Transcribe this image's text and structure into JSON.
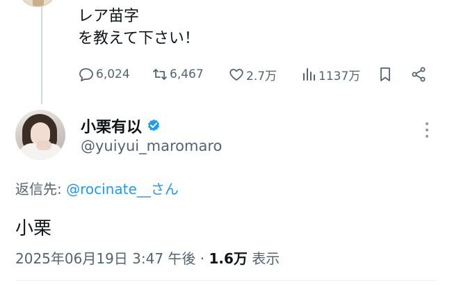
{
  "parent_tweet": {
    "lines": [
      "レア苗字",
      "を教えて下さい！"
    ],
    "actions": {
      "reply_count": "6,024",
      "retweet_count": "6,467",
      "like_count": "2.7万",
      "view_count": "1137万"
    }
  },
  "reply_tweet": {
    "author_name": "小栗有以",
    "handle": "@yuiyui_maromaro",
    "reply_prefix": "返信先: ",
    "reply_to": "@rocinate__さん",
    "text": "小栗",
    "timestamp": "2025年06月19日 3:47 午後 · ",
    "views_value": "1.6万",
    "views_label": " 表示"
  },
  "colors": {
    "text": "#0f1419",
    "secondary": "#536471",
    "accent": "#1d9bf0",
    "divider": "#eff3f4"
  },
  "icons": [
    "reply-icon",
    "retweet-icon",
    "like-icon",
    "views-icon",
    "bookmark-icon",
    "share-icon",
    "verified-badge-icon",
    "more-options-icon"
  ]
}
